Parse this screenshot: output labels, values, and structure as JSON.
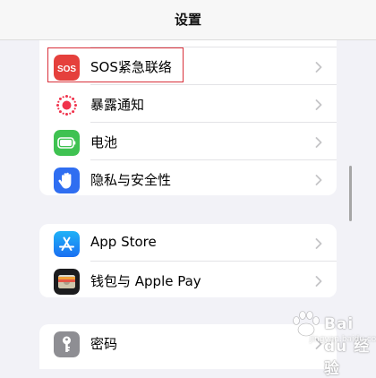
{
  "nav": {
    "title": "设置"
  },
  "groups": [
    {
      "items": [
        {
          "label": "SOS紧急联络",
          "icon": "sos-icon",
          "icon_text": "SOS",
          "color": "#e5403c"
        },
        {
          "label": "暴露通知",
          "icon": "exposure-notification-icon",
          "color": "#ffffff"
        },
        {
          "label": "电池",
          "icon": "battery-icon",
          "color": "#3fc251"
        },
        {
          "label": "隐私与安全性",
          "icon": "hand-icon",
          "color": "#2f6ef1"
        }
      ]
    },
    {
      "items": [
        {
          "label": "App Store",
          "icon": "app-store-icon",
          "color": "#1d8ef5"
        },
        {
          "label": "钱包与 Apple Pay",
          "icon": "wallet-icon",
          "color": "#1c1c1e"
        }
      ]
    },
    {
      "items": [
        {
          "label": "密码",
          "icon": "key-icon",
          "color": "#8e8e93"
        }
      ]
    }
  ],
  "watermark": {
    "text": "Bai du 经验",
    "url": "jingyan.baidu.com"
  },
  "colors": {
    "background": "#f2f2f7",
    "highlight": "#d9303a",
    "chevron": "#c4c4c7"
  }
}
